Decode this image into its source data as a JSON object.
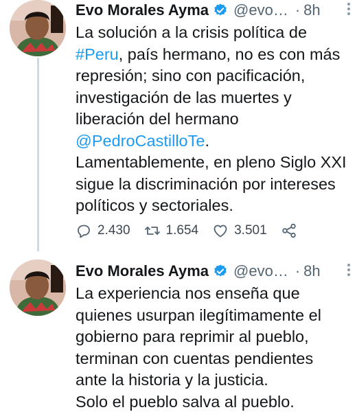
{
  "tweets": [
    {
      "author_name": "Evo Morales Ayma",
      "handle": "@evo…",
      "dot": "·",
      "time": "8h",
      "lines": [
        [
          {
            "t": "La solución a la crisis política de",
            "link": false
          }
        ],
        [
          {
            "t": "#Peru",
            "link": true
          },
          {
            "t": ", país hermano, no es con más",
            "link": false
          }
        ],
        [
          {
            "t": "represión; sino con pacificación,",
            "link": false
          }
        ],
        [
          {
            "t": "investigación de las muertes y",
            "link": false
          }
        ],
        [
          {
            "t": "liberación del hermano",
            "link": false
          }
        ],
        [
          {
            "t": "@PedroCastilloTe",
            "link": true
          },
          {
            "t": ".",
            "link": false
          }
        ],
        [
          {
            "t": "Lamentablemente, en pleno Siglo XXI",
            "link": false
          }
        ],
        [
          {
            "t": "sigue la discriminación por intereses",
            "link": false
          }
        ],
        [
          {
            "t": "políticos y sectoriales.",
            "link": false
          }
        ]
      ],
      "replies": "2.430",
      "retweets": "1.654",
      "likes": "3.501"
    },
    {
      "author_name": "Evo Morales Ayma",
      "handle": "@evo…",
      "dot": "·",
      "time": "8h",
      "lines": [
        [
          {
            "t": "La experiencia nos enseña que",
            "link": false
          }
        ],
        [
          {
            "t": "quienes usurpan ilegítimamente el",
            "link": false
          }
        ],
        [
          {
            "t": "gobierno para reprimir al pueblo,",
            "link": false
          }
        ],
        [
          {
            "t": "terminan con cuentas pendientes",
            "link": false
          }
        ],
        [
          {
            "t": "ante la historia y la justicia.",
            "link": false
          }
        ],
        [
          {
            "t": "Solo el pueblo salva al pueblo.",
            "link": false
          }
        ]
      ]
    }
  ],
  "icons": {
    "reply": "reply-icon",
    "retweet": "retweet-icon",
    "like": "heart-icon",
    "share": "share-icon",
    "verified": "verified-badge-icon",
    "more": "more-options-icon"
  },
  "colors": {
    "link": "#1d9bf0",
    "verified": "#1d9bf0",
    "secondary_text": "#536471"
  }
}
